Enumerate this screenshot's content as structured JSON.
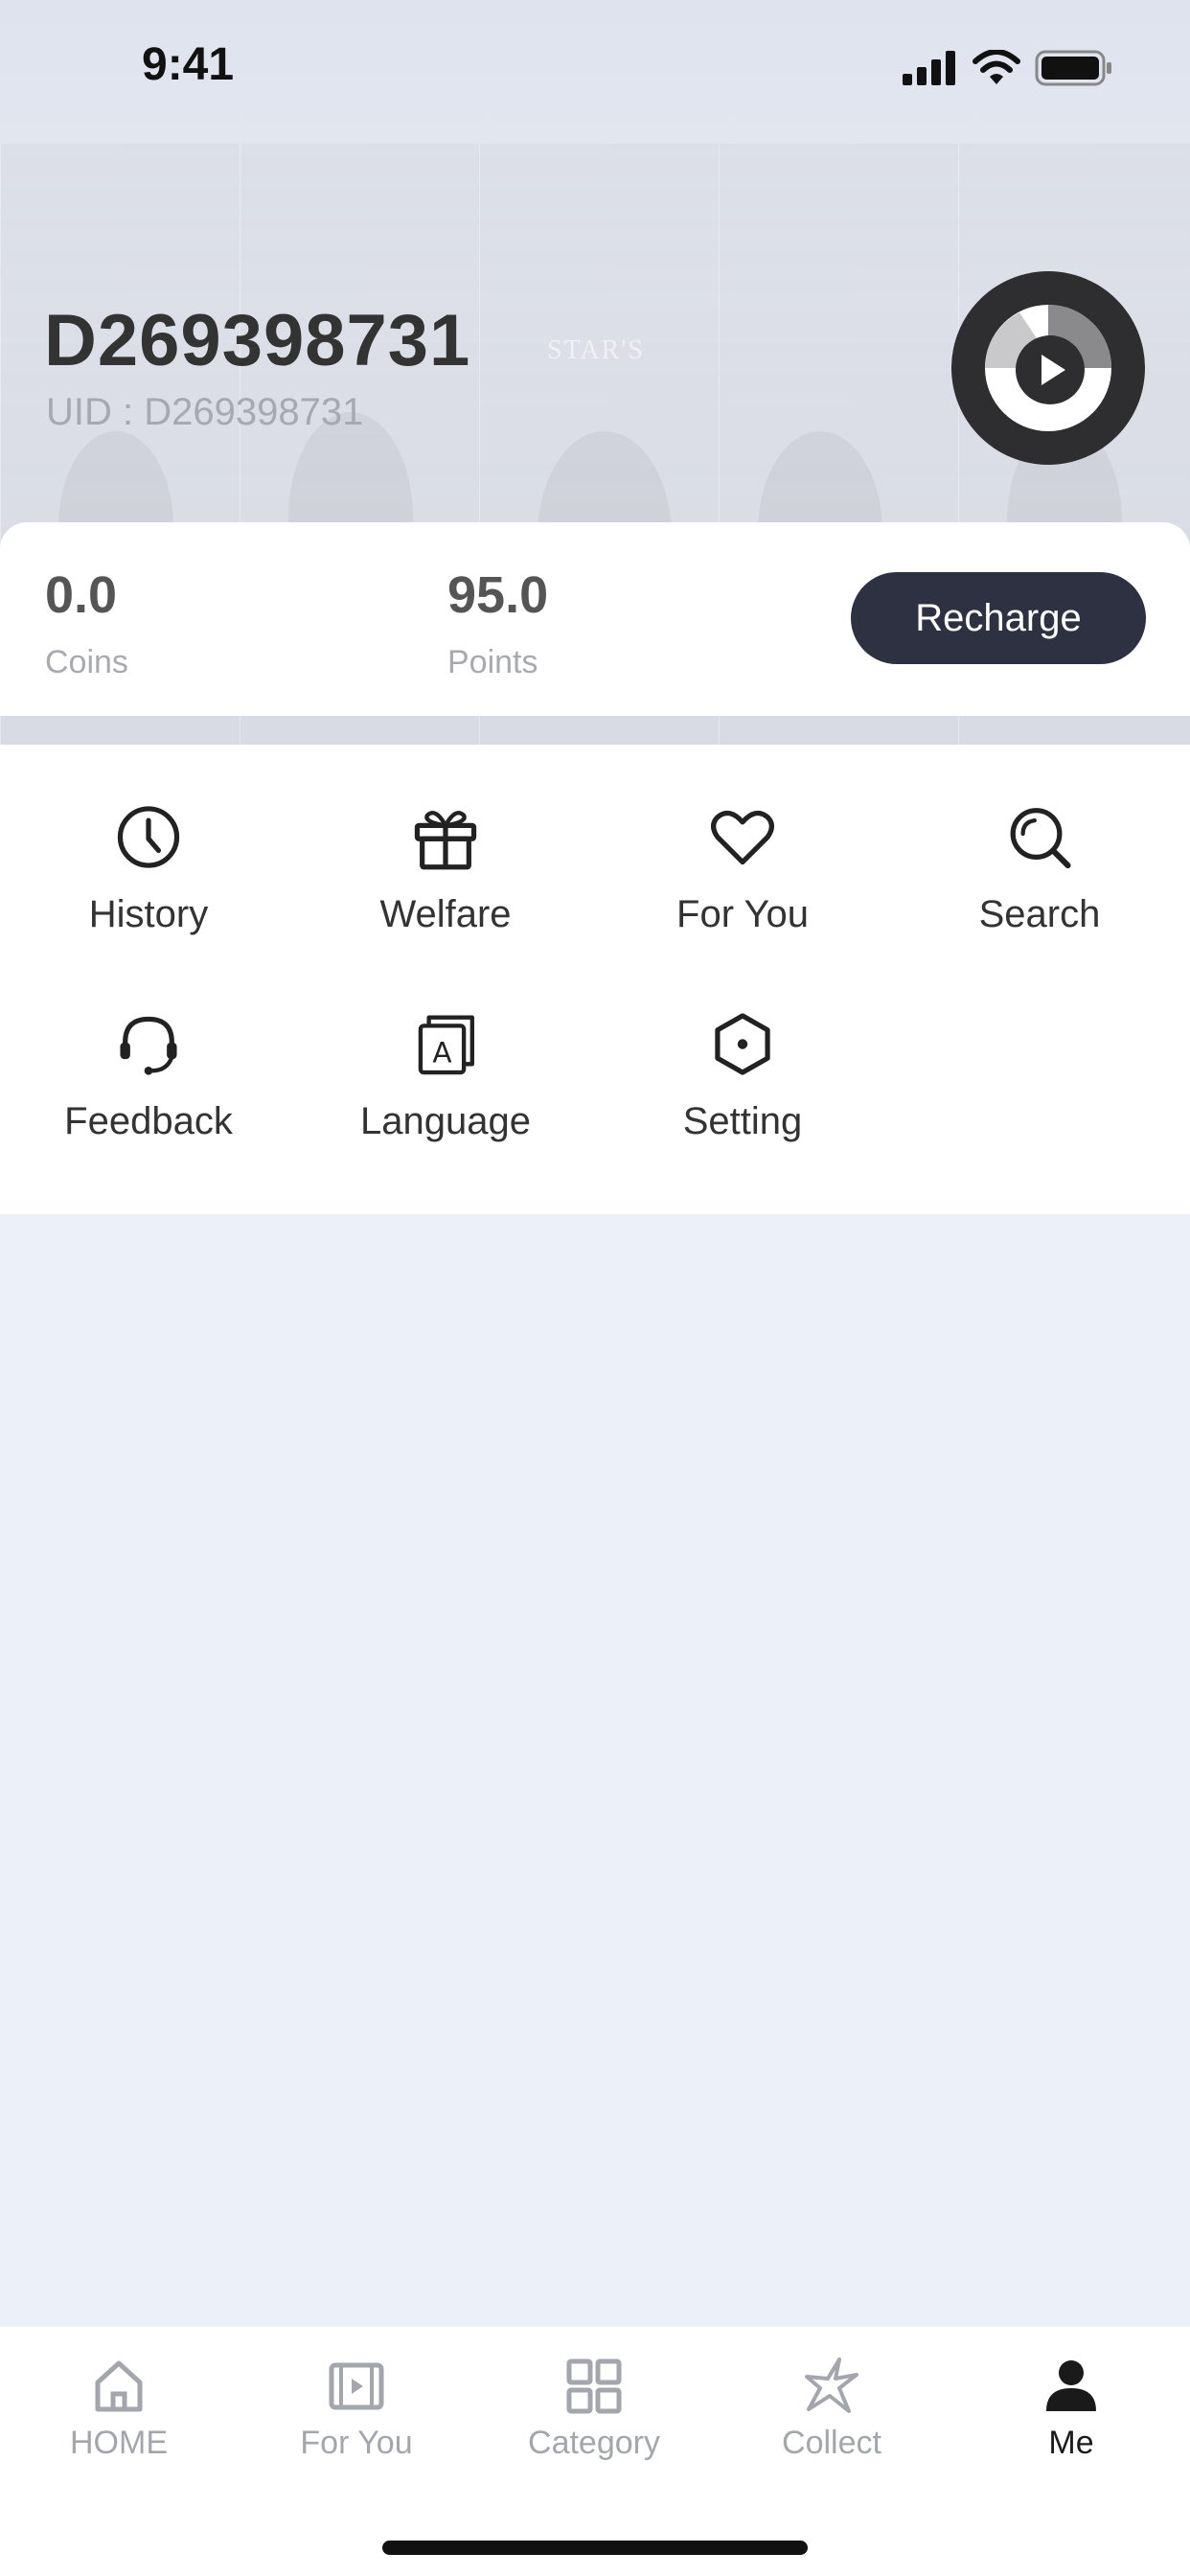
{
  "status_bar": {
    "time": "9:41"
  },
  "profile": {
    "username": "D269398731",
    "uid": "UID : D269398731"
  },
  "wallet": {
    "coins_value": "0.0",
    "coins_label": "Coins",
    "points_value": "95.0",
    "points_label": "Points",
    "recharge_label": "Recharge"
  },
  "menu": {
    "items": [
      {
        "label": "History",
        "icon": "clock-icon"
      },
      {
        "label": "Welfare",
        "icon": "gift-icon"
      },
      {
        "label": "For You",
        "icon": "heart-icon"
      },
      {
        "label": "Search",
        "icon": "search-icon"
      },
      {
        "label": "Feedback",
        "icon": "headset-icon"
      },
      {
        "label": "Language",
        "icon": "language-icon"
      },
      {
        "label": "Setting",
        "icon": "settings-hexagon-icon"
      }
    ]
  },
  "tabbar": {
    "items": [
      {
        "label": "HOME",
        "icon": "home-icon",
        "active": false
      },
      {
        "label": "For You",
        "icon": "video-play-icon",
        "active": false
      },
      {
        "label": "Category",
        "icon": "grid-icon",
        "active": false
      },
      {
        "label": "Collect",
        "icon": "star-icon",
        "active": false
      },
      {
        "label": "Me",
        "icon": "person-icon",
        "active": true
      }
    ]
  },
  "colors": {
    "page_bg": "#ECF0F9",
    "recharge_bg": "#2D3142",
    "avatar_bg": "#2E2E30",
    "inactive_tab": "#A4A6AD"
  }
}
